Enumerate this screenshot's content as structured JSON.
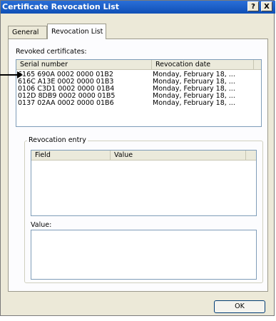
{
  "window": {
    "title": "Certificate Revocation List",
    "help_button": "?",
    "close_button": "X"
  },
  "tabs": [
    {
      "label": "General",
      "active": false
    },
    {
      "label": "Revocation List",
      "active": true
    }
  ],
  "revoked": {
    "label": "Revoked certificates:",
    "columns": [
      "Serial number",
      "Revocation date"
    ],
    "rows": [
      {
        "serial": "6165 690A 0002 0000 01B2",
        "date": "Monday, February 18, ..."
      },
      {
        "serial": "616C A13E 0002 0000 01B3",
        "date": "Monday, February 18, ..."
      },
      {
        "serial": "0106 C3D1 0002 0000 01B4",
        "date": "Monday, February 18, ..."
      },
      {
        "serial": "012D 8DB9 0002 0000 01B5",
        "date": "Monday, February 18, ..."
      },
      {
        "serial": "0137 02AA 0002 0000 01B6",
        "date": "Monday, February 18, ..."
      }
    ]
  },
  "entry": {
    "group_label": "Revocation entry",
    "columns": [
      "Field",
      "Value"
    ],
    "value_label": "Value:"
  },
  "buttons": {
    "ok": "OK"
  },
  "colors": {
    "titlebar": "#0f4fb5",
    "dialog_bg": "#ece9d8",
    "panel_bg": "#fcfcfe",
    "list_border": "#7f9db9"
  }
}
